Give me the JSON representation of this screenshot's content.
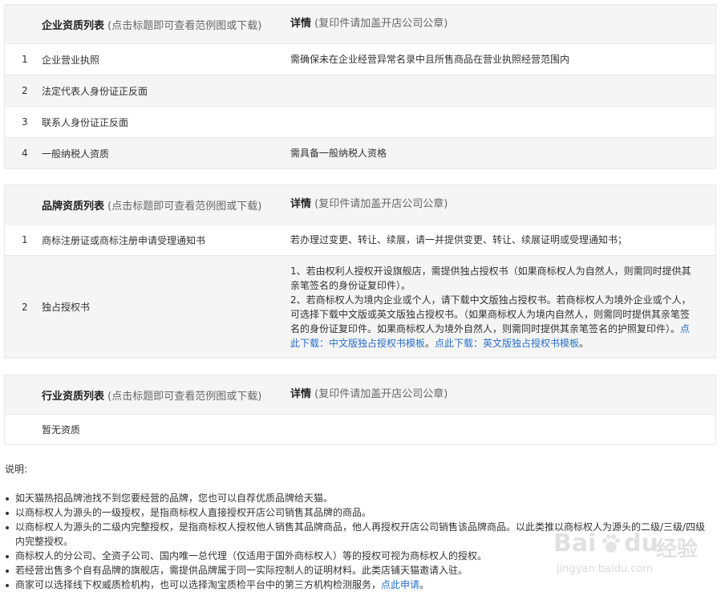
{
  "enterprise": {
    "title": "企业资质列表",
    "title_note": "(点击标题即可查看范例图或下载)",
    "detail_title": "详情",
    "detail_note": "(复印件请加盖开店公司公章)",
    "rows": [
      {
        "num": "1",
        "name": "企业营业执照",
        "detail": "需确保未在企业经营异常名录中且所售商品在营业执照经营范围内"
      },
      {
        "num": "2",
        "name": "法定代表人身份证正反面",
        "detail": ""
      },
      {
        "num": "3",
        "name": "联系人身份证正反面",
        "detail": ""
      },
      {
        "num": "4",
        "name": "一般纳税人资质",
        "detail": "需具备一般纳税人资格"
      }
    ]
  },
  "brand": {
    "title": "品牌资质列表",
    "title_note": "(点击标题即可查看范例图或下载)",
    "detail_title": "详情",
    "detail_note": "(复印件请加盖开店公司公章)",
    "row1": {
      "num": "1",
      "name": "商标注册证或商标注册申请受理通知书",
      "detail": "若办理过变更、转让、续展，请一并提供变更、转让、续展证明或受理通知书；"
    },
    "row2": {
      "num": "2",
      "name": "独占授权书",
      "line1": "1、若由权利人授权开设旗舰店，需提供独占授权书（如果商标权人为自然人，则需同时提供其亲笔签名的身份证复印件）。",
      "line2": "2、若商标权人为境内企业或个人，请下载中文版独占授权书。若商标权人为境外企业或个人，可选择下载中文版或英文版独占授权书。（如果商标权人为境内自然人，则需同时提供其亲笔签名的身份证复印件。如果商标权人为境外自然人，则需同时提供其亲笔签名的护照复印件）。",
      "link1": "点此下载：中文版独占授权书模板",
      "sep": "。",
      "link2": "点此下载：英文版独占授权书模板",
      "end": "。"
    }
  },
  "industry": {
    "title": "行业资质列表",
    "title_note": "(点击标题即可查看范例图或下载)",
    "detail_title": "详情",
    "detail_note": "(复印件请加盖开店公司公章)",
    "empty": "暂无资质"
  },
  "notes": {
    "title": "说明:",
    "items": [
      "如天猫热招品牌池找不到您要经营的品牌，您也可以自荐优质品牌给天猫。",
      "以商标权人为源头的一级授权，是指商标权人直接授权开店公司销售其品牌的商品。",
      "以商标权人为源头的二级内完整授权，是指商标权人授权他人销售其品牌商品，他人再授权开店公司销售该品牌商品。以此类推以商标权人为源头的二级/三级/四级内完整授权。",
      "商标权人的分公司、全资子公司、国内唯一总代理（仅适用于国外商标权人）等的授权可视为商标权人的授权。",
      "若经营出售多个自有品牌的旗舰店，需提供品牌属于同一实际控制人的证明材料。此类店铺天猫邀请入驻。"
    ],
    "last_text": "商家可以选择线下权威质检机构，也可以选择淘宝质检平台中的第三方机构检测服务，",
    "last_link": "点此申请",
    "last_end": "。"
  },
  "watermark": {
    "brand": "Bai",
    "brand2": "du",
    "cn": "经验",
    "url": "jingyan.baidu.com"
  }
}
